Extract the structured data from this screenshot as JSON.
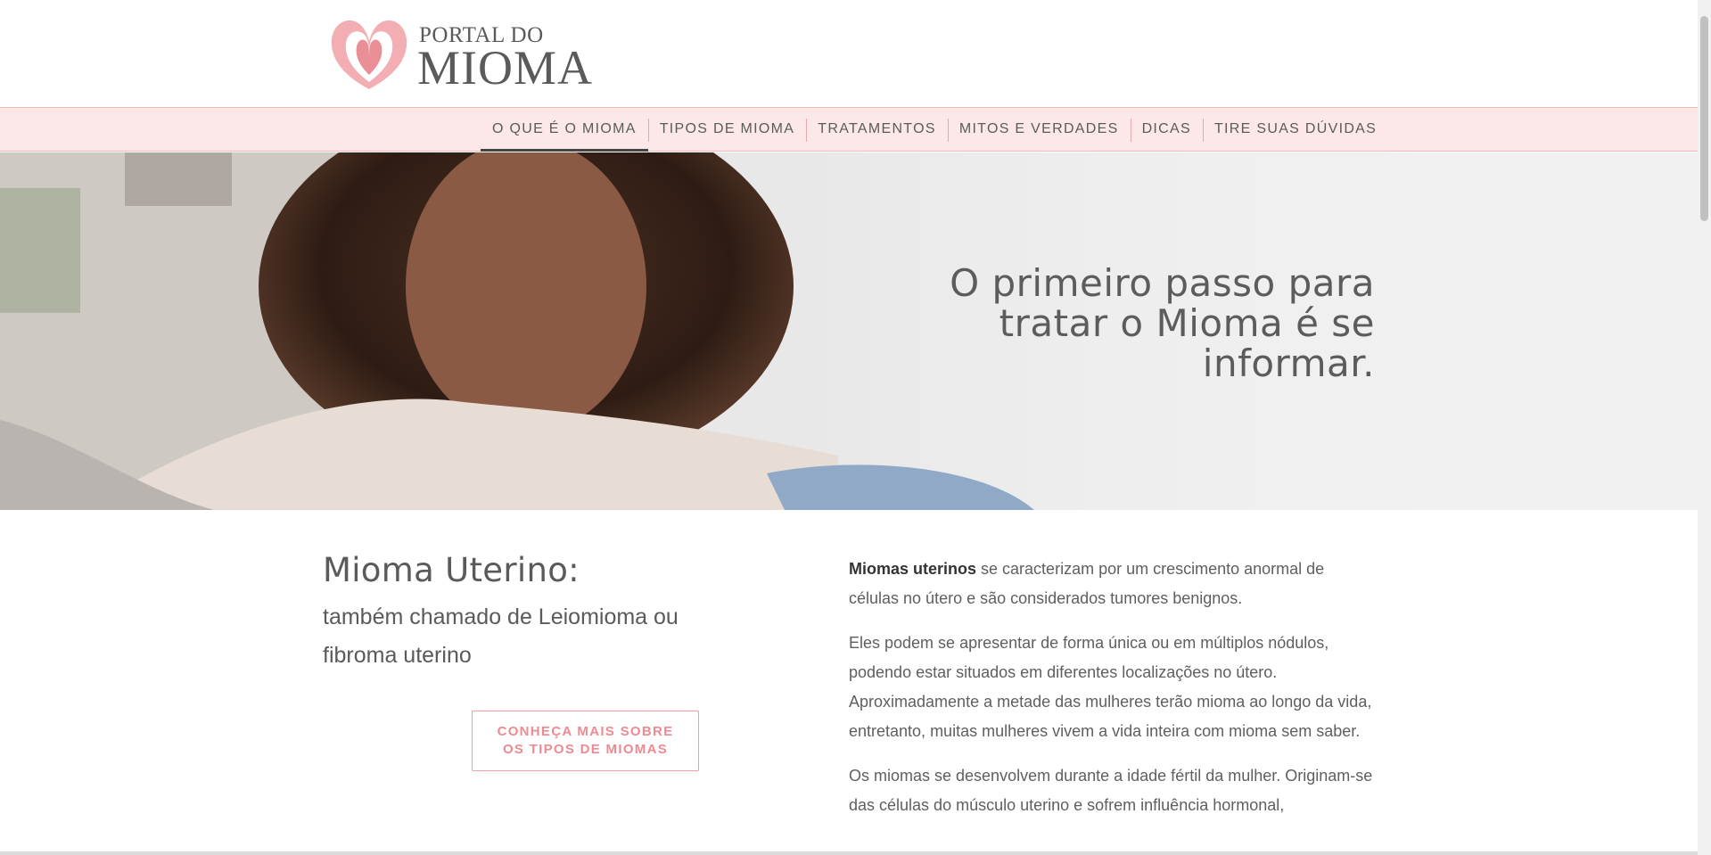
{
  "brand": {
    "logo_top": "PORTAL DO",
    "logo_main": "MIOMA",
    "logo_color": "#f0a5ab"
  },
  "nav": {
    "items": [
      {
        "label": "O QUE É O MIOMA",
        "active": true
      },
      {
        "label": "TIPOS DE MIOMA",
        "active": false
      },
      {
        "label": "TRATAMENTOS",
        "active": false
      },
      {
        "label": "MITOS E VERDADES",
        "active": false
      },
      {
        "label": "DICAS",
        "active": false
      },
      {
        "label": "TIRE SUAS DÚVIDAS",
        "active": false
      }
    ],
    "background": "#fde8e9"
  },
  "hero": {
    "title": "O primeiro passo para tratar o Mioma é se informar."
  },
  "main": {
    "title": "Mioma Uterino:",
    "subtitle": "também chamado de Leiomioma ou fibroma uterino",
    "cta_label": "CONHEÇA MAIS SOBRE\nOS TIPOS DE MIOMAS",
    "p1_strong": "Miomas uterinos",
    "p1_rest": " se caracterizam por um crescimento anormal de células no útero e são considerados tumores benignos.",
    "p2": "Eles podem se apresentar de forma única ou em múltiplos nódulos, podendo estar situados em diferentes localizações no útero. Aproximadamente a metade das mulheres terão mioma ao longo da vida, entretanto, muitas mulheres vivem a vida inteira com mioma sem saber.",
    "p3": "Os miomas se desenvolvem durante a idade fértil da mulher. Originam-se das células do músculo uterino e sofrem influência hormonal,"
  },
  "colors": {
    "accent": "#ef8a92",
    "text": "#5a5a5a"
  }
}
